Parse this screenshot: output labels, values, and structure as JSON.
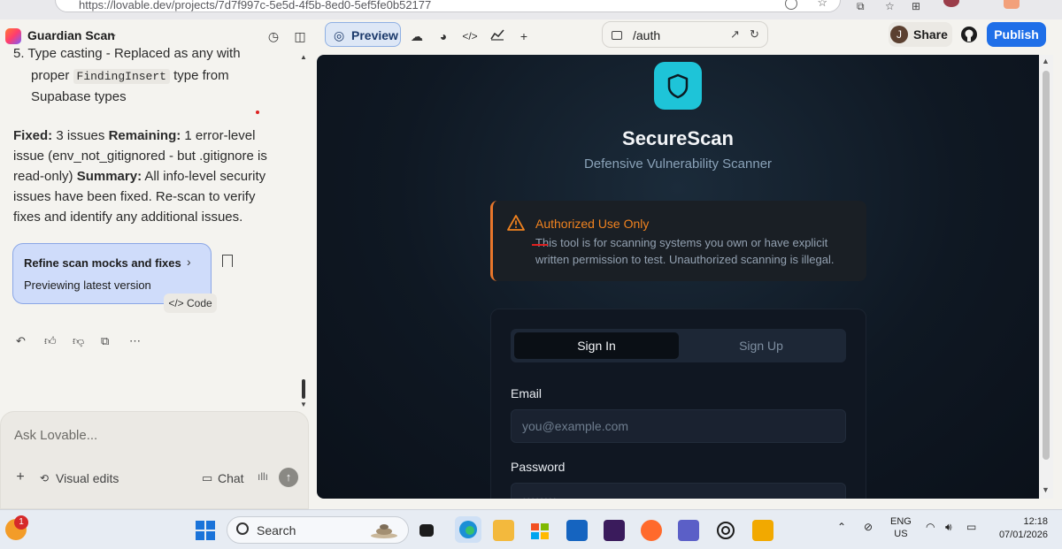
{
  "browser": {
    "url": "https://lovable.dev/projects/7d7f997c-5e5d-4f5b-8ed0-5ef5fe0b52177"
  },
  "header": {
    "project_name": "Guardian Scan",
    "preview_label": "Preview",
    "route": "/auth",
    "share_initial": "J",
    "share_label": "Share",
    "publish_label": "Publish"
  },
  "chat": {
    "cut_line": "5. Type casting - Replaced as any with",
    "paragraph1": {
      "pre": "proper ",
      "code": "FindingInsert",
      "post": " type from Supabase types"
    },
    "paragraph2": {
      "fixed_label": "Fixed:",
      "fixed_text": " 3 issues ",
      "remaining_label": "Remaining:",
      "remaining_text": " 1 error-level issue (env_not_gitignored - but .gitignore is read-only) ",
      "summary_label": "Summary:",
      "summary_text": " All info-level security issues have been fixed. Re-scan to verify fixes and identify any additional issues."
    },
    "card_title": "Refine scan mocks and fixes",
    "card_subtitle": "Previewing latest version",
    "code_button": "Code",
    "input_placeholder": "Ask Lovable...",
    "visual_edits": "Visual edits",
    "chat_button": "Chat"
  },
  "preview": {
    "brand": "SecureScan",
    "tagline": "Defensive Vulnerability Scanner",
    "warning_title": "Authorized Use Only",
    "warning_body": "This tool is for scanning systems you own or have explicit written permission to test. Unauthorized scanning is illegal.",
    "tab_signin": "Sign In",
    "tab_signup": "Sign Up",
    "email_label": "Email",
    "email_placeholder": "you@example.com",
    "password_label": "Password",
    "password_value": "••••••••"
  },
  "taskbar": {
    "weather_badge": "1",
    "search_label": "Search",
    "lang_line1": "ENG",
    "lang_line2": "US",
    "time": "12:18",
    "date": "07/01/2026"
  },
  "colors": {
    "accent_blue": "#1f6fe8",
    "shield_cyan": "#1ec4d8",
    "warning_orange": "#f0821f",
    "card_blue": "#cfdcfa"
  }
}
